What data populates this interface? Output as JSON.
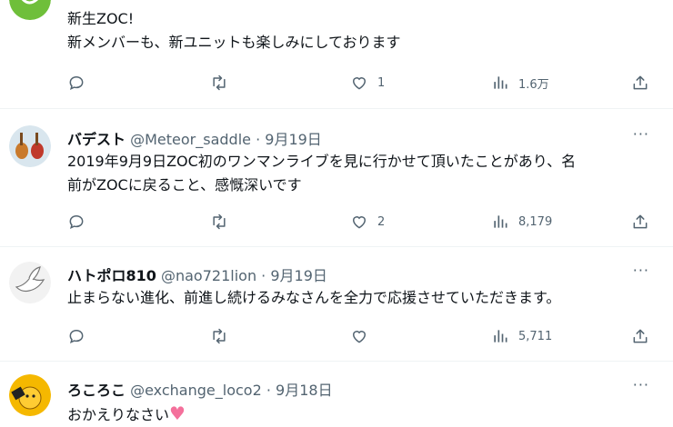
{
  "tweets": [
    {
      "name": "",
      "handle": "",
      "date": "",
      "text": [
        "新生ZOC!",
        "新メンバーも、新ユニットも楽しみにしております"
      ],
      "replies": "",
      "retweets": "",
      "likes": "1",
      "views": "1.6万",
      "avatar_color": "#6fbf3a"
    },
    {
      "name": "バデスト",
      "handle": "@Meteor_saddle",
      "date": "9月19日",
      "text": [
        "2019年9月9日ZOC初のワンマンライブを見に行かせて頂いたことがあり、名",
        "前がZOCに戻ること、感慨深いです"
      ],
      "replies": "",
      "retweets": "",
      "likes": "2",
      "views": "8,179",
      "avatar_color": "#d9e6ee"
    },
    {
      "name": "ハトポロ810",
      "handle": "@nao721lion",
      "date": "9月19日",
      "text": [
        "止まらない進化、前進し続けるみなさんを全力で応援させていただきます。"
      ],
      "replies": "",
      "retweets": "",
      "likes": "",
      "views": "5,711",
      "avatar_color": "#f2f2f2"
    },
    {
      "name": "ろころこ",
      "handle": "@exchange_loco2",
      "date": "9月18日",
      "text": [
        "おかえりなさい"
      ],
      "emoji": "♥",
      "avatar_color": "#f5b800"
    }
  ],
  "dot": "·",
  "more_glyph": "···",
  "colors": {
    "muted": "#536471",
    "heart": "#f4709b",
    "text": "#0f1419"
  },
  "icons": [
    "reply-icon",
    "retweet-icon",
    "like-icon",
    "views-icon",
    "share-icon",
    "more-icon"
  ]
}
